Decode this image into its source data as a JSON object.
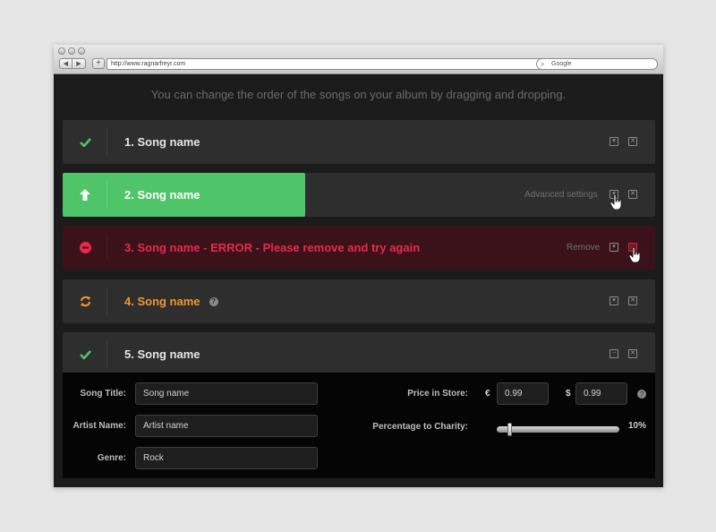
{
  "browser": {
    "url": "http://www.ragnarfreyr.com",
    "search_placeholder": "Google"
  },
  "instructions": "You can change the order of the songs on your album by dragging and dropping.",
  "songs": [
    {
      "name": "1. Song name",
      "state": "done",
      "status_icon": "check-icon"
    },
    {
      "name": "2. Song name",
      "state": "uploading",
      "status_icon": "upload-arrow-icon",
      "hint": "Advanced settings",
      "progress": 0.41
    },
    {
      "name": "3. Song name - ERROR - Please remove and try again",
      "state": "error",
      "status_icon": "error-minus-icon",
      "hint": "Remove"
    },
    {
      "name": "4. Song name",
      "state": "processing",
      "status_icon": "refresh-icon",
      "help": "?"
    },
    {
      "name": "5. Song name",
      "state": "done",
      "status_icon": "check-icon"
    }
  ],
  "details": {
    "song_title_label": "Song Title:",
    "song_title_value": "Song name",
    "artist_name_label": "Artist Name:",
    "artist_name_value": "Artist name",
    "genre_label": "Genre:",
    "genre_value": "Rock",
    "price_label": "Price in Store:",
    "price_euro_symbol": "€",
    "price_euro_value": "0.99",
    "price_usd_symbol": "$",
    "price_usd_value": "0.99",
    "help": "?",
    "charity_label": "Percentage to Charity:",
    "charity_percent": "10%",
    "charity_fraction": 0.1
  },
  "colors": {
    "success": "#50c468",
    "error": "#e8284f",
    "warning": "#f3962f"
  }
}
